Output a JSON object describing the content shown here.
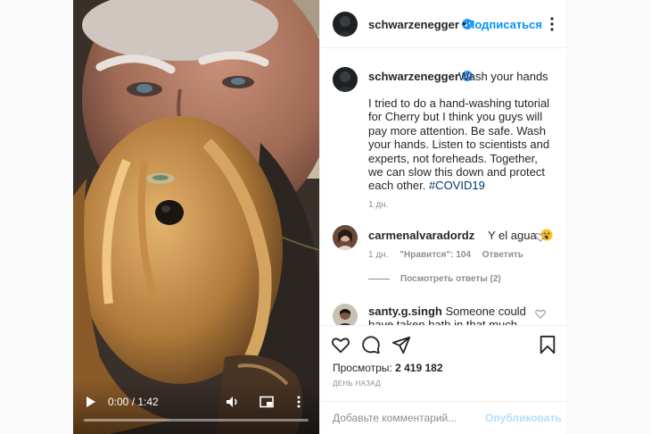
{
  "video": {
    "time_display": "0:00 / 1:42",
    "progress": 0.0,
    "icons": [
      "play-icon",
      "volume-icon",
      "picture-in-picture-icon",
      "more-vertical-icon"
    ]
  },
  "header": {
    "username": "schwarzenegger",
    "separator": "•",
    "follow_label": "Подписаться"
  },
  "caption": {
    "username": "schwarzenegger",
    "first_line": "Wash your hands",
    "body": "I tried to do a hand-washing tutorial for Cherry but I think you guys will pay more attention. Be safe. Wash your hands. Listen to scientists and experts, not foreheads. Together, we can slow this down and protect each other.",
    "hashtag": "#COVID19",
    "time": "1 дн."
  },
  "comments": [
    {
      "username": "carmenalvaradordz",
      "text": "Y el agua",
      "emoji": "astonished-face",
      "time": "1 дн.",
      "likes": "\"Нравится\": 104",
      "reply_label": "Ответить",
      "view_replies": "Посмотреть ответы (2)"
    },
    {
      "username": "santy.g.singh",
      "text": "Someone could have taken bath in that much"
    }
  ],
  "actions": {
    "views_label": "Просмотры:",
    "views_count": "2 419 182",
    "date": "ДЕНЬ НАЗАД",
    "comment_placeholder": "Добавьте комментарий...",
    "publish_label": "Опубликовать"
  },
  "colors": {
    "accent": "#0095f6",
    "publish_disabled": "#b2dffc",
    "hashtag": "#00376b",
    "muted": "#8e8e8e"
  }
}
